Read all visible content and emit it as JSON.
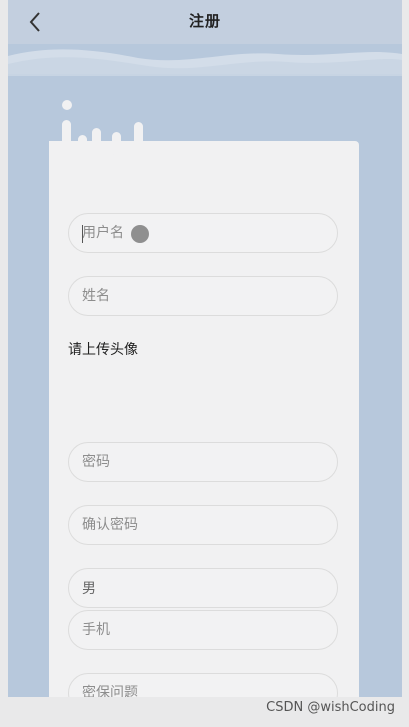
{
  "nav": {
    "title": "注册",
    "back_icon": "chevron-left-icon"
  },
  "form": {
    "username": {
      "placeholder": "用户名",
      "value": ""
    },
    "name": {
      "placeholder": "姓名",
      "value": ""
    },
    "avatar": {
      "label": "请上传头像"
    },
    "password": {
      "placeholder": "密码",
      "value": ""
    },
    "confirm_password": {
      "placeholder": "确认密码",
      "value": ""
    },
    "gender": {
      "value": "男"
    },
    "phone": {
      "placeholder": "手机",
      "value": ""
    },
    "security_question": {
      "placeholder": "密保问题",
      "value": ""
    }
  },
  "watermark": "CSDN @wishCoding",
  "colors": {
    "background": "#b7c8dc",
    "card": "#f1f1f2",
    "navbar": "#c3cfdf"
  }
}
